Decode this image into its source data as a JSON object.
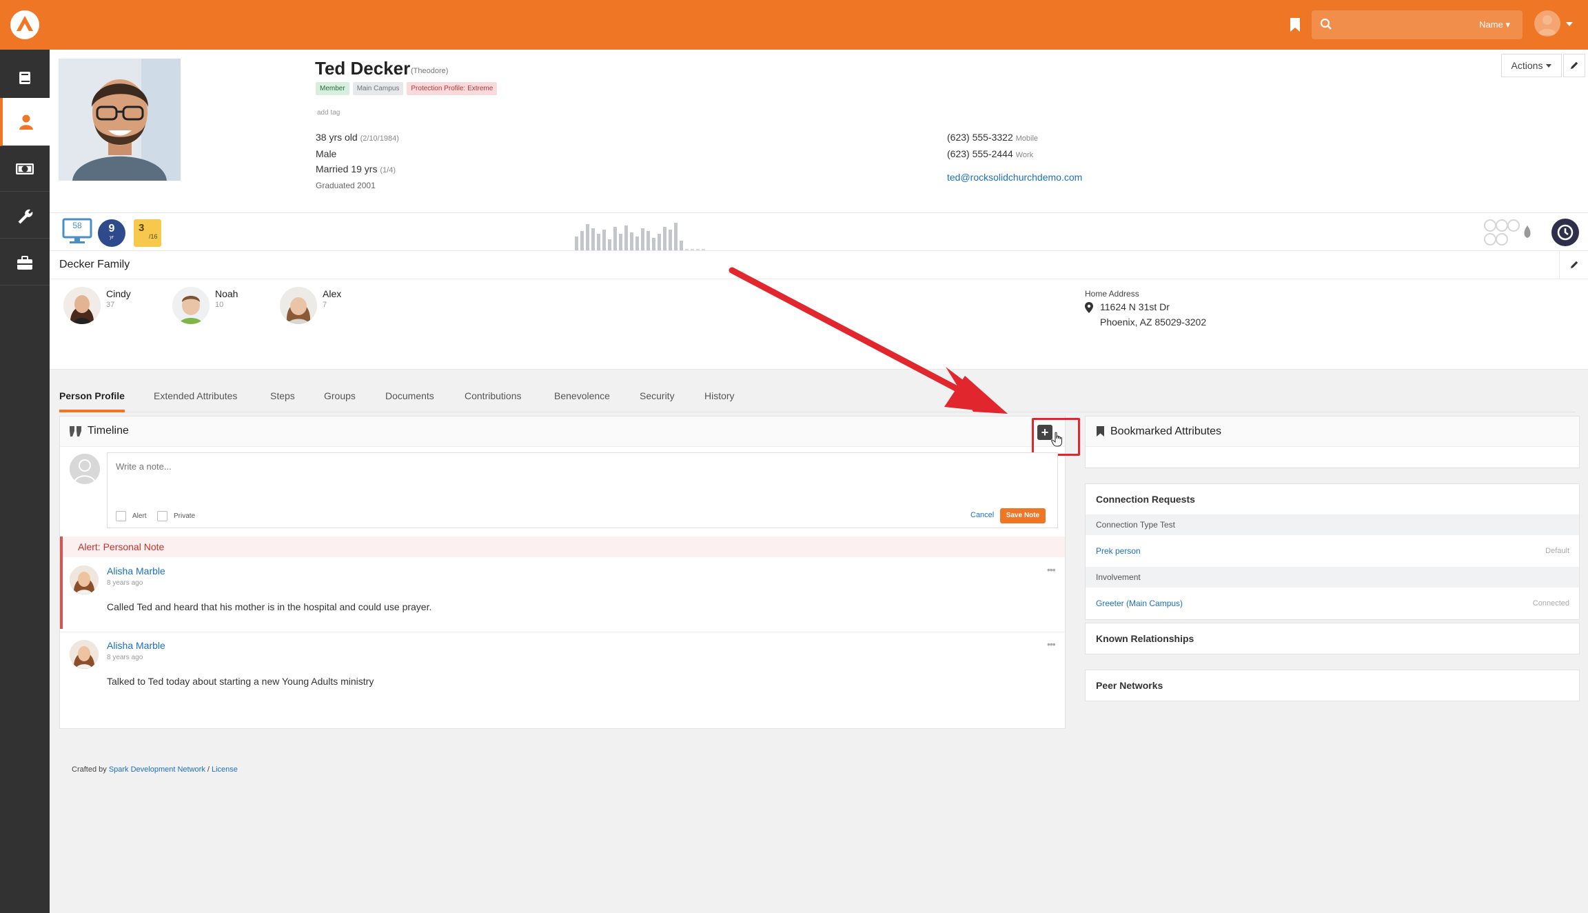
{
  "search": {
    "placeholder": "",
    "scope_label": "Name ▾"
  },
  "header": {
    "name": "Ted Decker",
    "nickname": "(Theodore)",
    "tags": [
      "Member",
      "Main Campus",
      "Protection Profile: Extreme"
    ],
    "add_tag": "add tag",
    "age": "38 yrs old",
    "birthdate": "(2/10/1984)",
    "gender": "Male",
    "married": "Married 19 yrs",
    "anniversary": "(1/4)",
    "graduated": "Graduated 2001",
    "phone_mobile": "(623) 555-3322",
    "phone_mobile_label": "Mobile",
    "phone_work": "(623) 555-2444",
    "phone_work_label": "Work",
    "email": "ted@rocksolidchurchdemo.com",
    "actions_label": "Actions"
  },
  "badges": {
    "attendance": "58",
    "years": "9",
    "years_unit": "yr",
    "serving": "3",
    "serving_den": "/16",
    "giving_levels": [
      0.5,
      0.7,
      0.95,
      0.8,
      0.6,
      0.75,
      0.4,
      0.85,
      0.6,
      0.9,
      0.65,
      0.5,
      0.8,
      0.7,
      0.45,
      0.6,
      0.85,
      0.75,
      1.0,
      0.35,
      0,
      0,
      0,
      0
    ]
  },
  "family": {
    "title": "Decker Family",
    "members": [
      {
        "name": "Cindy",
        "age": "37"
      },
      {
        "name": "Noah",
        "age": "10"
      },
      {
        "name": "Alex",
        "age": "7"
      }
    ],
    "address_label": "Home Address",
    "address_line1": "11624 N 31st Dr",
    "address_line2": "Phoenix, AZ 85029-3202"
  },
  "tabs": [
    "Person Profile",
    "Extended Attributes",
    "Steps",
    "Groups",
    "Documents",
    "Contributions",
    "Benevolence",
    "Security",
    "History"
  ],
  "timeline": {
    "title": "Timeline",
    "note_placeholder": "Write a note...",
    "alert_label": "Alert",
    "private_label": "Private",
    "cancel_label": "Cancel",
    "save_label": "Save Note",
    "alert_banner": "Alert: Personal Note",
    "notes": [
      {
        "author": "Alisha Marble",
        "ago": "8 years ago",
        "text": "Called Ted and heard that his mother is in the hospital and could use prayer."
      },
      {
        "author": "Alisha Marble",
        "ago": "8 years ago",
        "text": "Talked to Ted today about starting a new Young Adults ministry"
      }
    ]
  },
  "right": {
    "bookmarked_title": "Bookmarked Attributes",
    "connection_title": "Connection Requests",
    "connection_type_1": "Connection Type Test",
    "connection_item_1": "Prek person",
    "connection_status_1": "Default",
    "connection_type_2": "Involvement",
    "connection_item_2": "Greeter (Main Campus)",
    "connection_status_2": "Connected",
    "known_relationships": "Known Relationships",
    "peer_networks": "Peer Networks"
  },
  "footer": {
    "crafted_by": "Crafted by",
    "spark": "Spark Development Network",
    "slash": " / ",
    "license": "License"
  },
  "colors": {
    "brand": "#ee7625",
    "sidebar": "#323232",
    "alert": "#d9534f",
    "link": "#1a6fc4",
    "highlight": "#e2262e"
  }
}
